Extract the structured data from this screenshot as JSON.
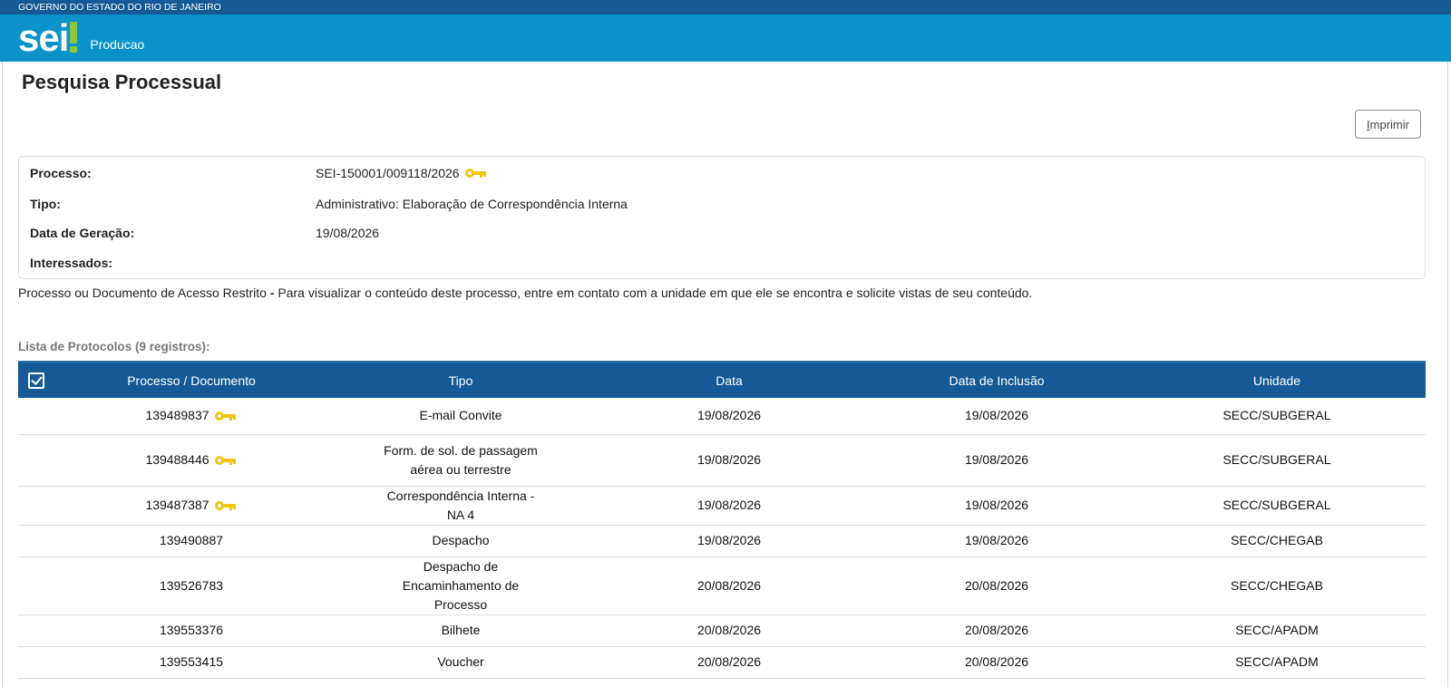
{
  "gov_bar": {
    "text": "GOVERNO DO ESTADO DO RIO DE JANEIRO"
  },
  "app_bar": {
    "logo_text": "sei",
    "environment": "Producao"
  },
  "page": {
    "title": "Pesquisa Processual"
  },
  "toolbar": {
    "print_label": "Imprimir"
  },
  "process_info": {
    "processo_label": "Processo:",
    "processo_value": "SEI-150001/009118/2026",
    "tipo_label": "Tipo:",
    "tipo_value": "Administrativo: Elaboração de Correspondência Interna",
    "data_label": "Data de Geração:",
    "data_value": "19/08/2026",
    "interessados_label": "Interessados:"
  },
  "notice": {
    "bold": "Processo ou Documento de Acesso Restrito - ",
    "text": "Para visualizar o conteúdo deste processo, entre em contato com a unidade em que ele se encontra e solicite vistas de seu conteúdo."
  },
  "protocol_list": {
    "caption": "Lista de Protocolos (9 registros):",
    "columns": [
      "Processo / Documento",
      "Tipo",
      "Data",
      "Data de Inclusão",
      "Unidade"
    ],
    "rows": [
      {
        "protocolo": "139489837",
        "restricted": true,
        "tipo": "E-mail Convite",
        "data": "19/08/2026",
        "inclusao": "19/08/2026",
        "unidade": "SECC/SUBGERAL"
      },
      {
        "protocolo": "139488446",
        "restricted": true,
        "tipo": "Form. de sol. de passagem aérea ou terrestre",
        "data": "19/08/2026",
        "inclusao": "19/08/2026",
        "unidade": "SECC/SUBGERAL"
      },
      {
        "protocolo": "139487387",
        "restricted": true,
        "tipo": "Correspondência Interna - NA 4",
        "data": "19/08/2026",
        "inclusao": "19/08/2026",
        "unidade": "SECC/SUBGERAL"
      },
      {
        "protocolo": "139490887",
        "restricted": false,
        "tipo": "Despacho",
        "data": "19/08/2026",
        "inclusao": "19/08/2026",
        "unidade": "SECC/CHEGAB"
      },
      {
        "protocolo": "139526783",
        "restricted": false,
        "tipo": "Despacho de Encaminhamento de Processo",
        "data": "20/08/2026",
        "inclusao": "20/08/2026",
        "unidade": "SECC/CHEGAB"
      },
      {
        "protocolo": "139553376",
        "restricted": false,
        "tipo": "Bilhete",
        "data": "20/08/2026",
        "inclusao": "20/08/2026",
        "unidade": "SECC/APADM"
      },
      {
        "protocolo": "139553415",
        "restricted": false,
        "tipo": "Voucher",
        "data": "20/08/2026",
        "inclusao": "20/08/2026",
        "unidade": "SECC/APADM"
      }
    ]
  },
  "colors": {
    "gov_bar": "#155a96",
    "app_bar": "#0a93c9",
    "logo_accent": "#8cc63f",
    "table_header": "#155a96",
    "key_icon": "#f2c40d"
  }
}
